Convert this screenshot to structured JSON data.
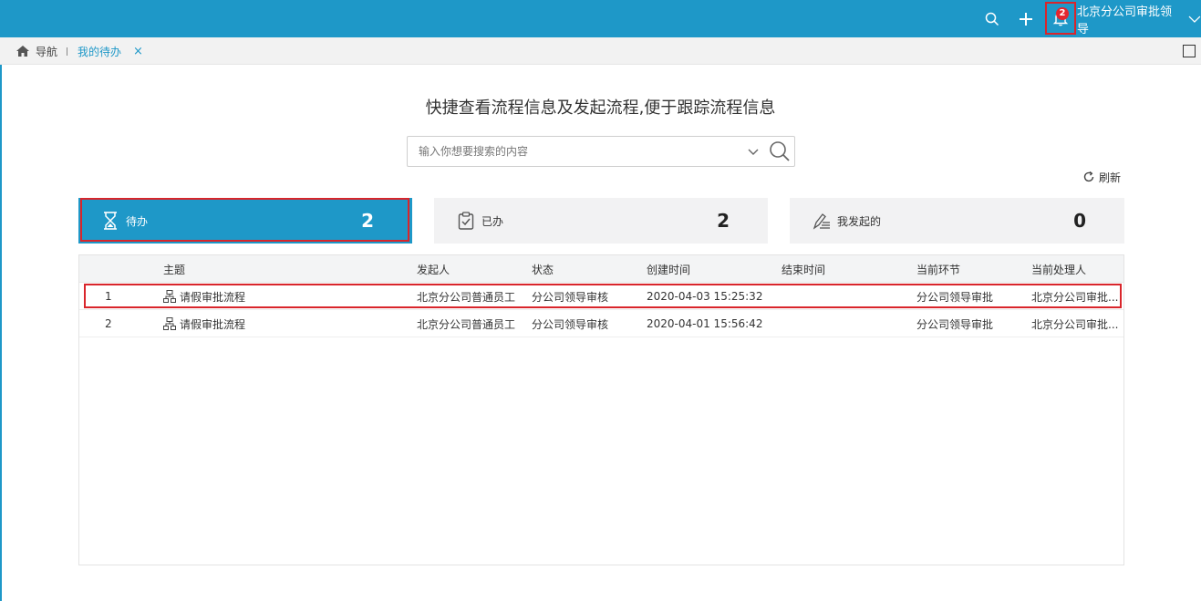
{
  "topbar": {
    "notification_count": "2",
    "user_name": "北京分公司审批领导",
    "accent_color": "#1e98c8",
    "icons": [
      "search-icon",
      "plus-icon",
      "bell-icon",
      "chevron-down-icon"
    ]
  },
  "tabsbar": {
    "home_label": "导航",
    "active_tab": "我的待办",
    "close_glyph": "×"
  },
  "main": {
    "headline": "快捷查看流程信息及发起流程,便于跟踪流程信息",
    "search_placeholder": "输入你想要搜索的内容",
    "refresh_label": "刷新"
  },
  "cards": [
    {
      "label": "待办",
      "count": "2",
      "icon": "hourglass-icon",
      "active": true
    },
    {
      "label": "已办",
      "count": "2",
      "icon": "clipboard-check-icon",
      "active": false
    },
    {
      "label": "我发起的",
      "count": "0",
      "icon": "edit-list-icon",
      "active": false
    }
  ],
  "table": {
    "headers": [
      "",
      "主题",
      "发起人",
      "状态",
      "创建时间",
      "结束时间",
      "当前环节",
      "当前处理人"
    ],
    "rows": [
      {
        "idx": "1",
        "subject": "请假审批流程",
        "initiator": "北京分公司普通员工",
        "status": "分公司领导审核",
        "created": "2020-04-03 15:25:32",
        "ended": "",
        "node": "分公司领导审批",
        "handler": "北京分公司审批..."
      },
      {
        "idx": "2",
        "subject": "请假审批流程",
        "initiator": "北京分公司普通员工",
        "status": "分公司领导审核",
        "created": "2020-04-01 15:56:42",
        "ended": "",
        "node": "分公司领导审批",
        "handler": "北京分公司审批..."
      }
    ]
  }
}
